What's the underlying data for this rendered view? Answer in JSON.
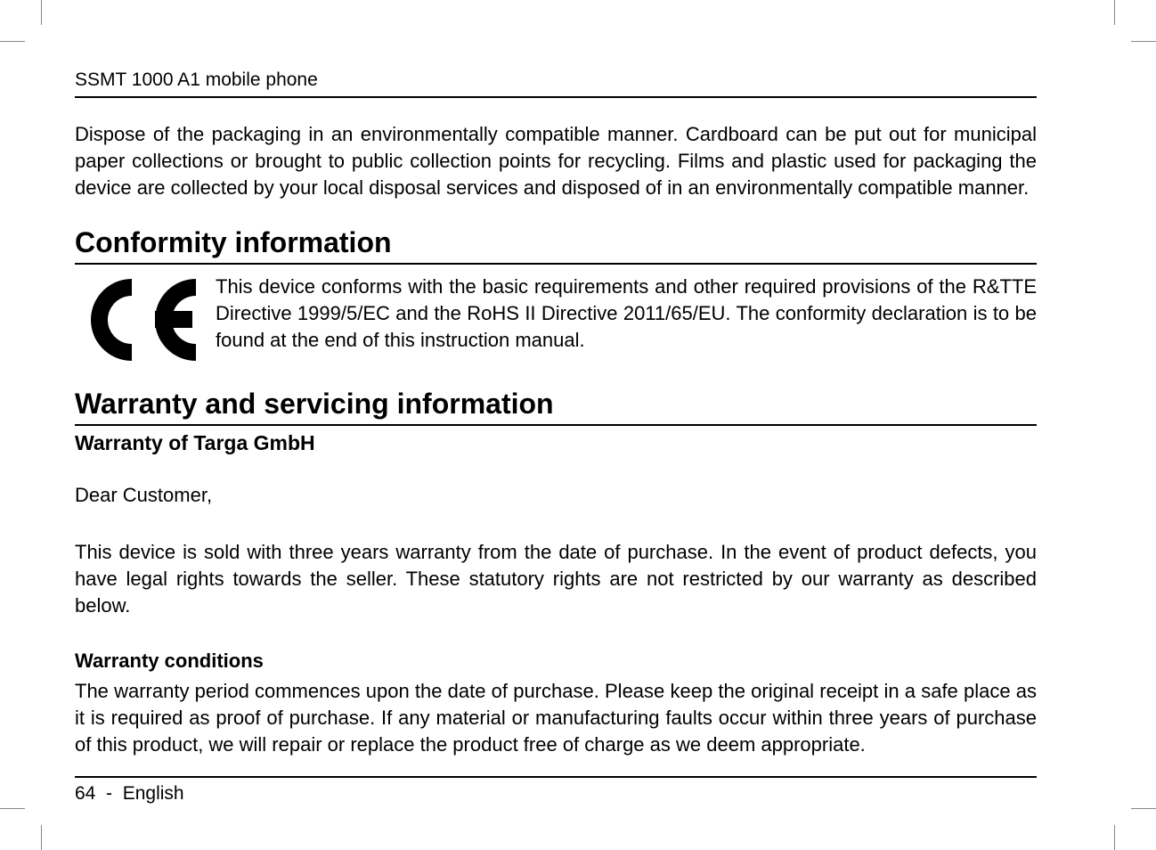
{
  "header": {
    "title": "SSMT 1000 A1 mobile phone"
  },
  "intro_para": "Dispose of the packaging in an environmentally compatible manner. Cardboard can be put out for municipal paper collections or brought to public collection points for recycling. Films and plastic used for packaging the device are collected by your local disposal services and disposed of in an environmentally compatible manner.",
  "conformity": {
    "heading": "Conformity information",
    "text": "This device conforms with the basic requirements and other required provisions of the R&TTE Directive 1999/5/EC and the RoHS II Directive 2011/65/EU. The conformity declaration is to be found at the end of this instruction manual."
  },
  "warranty": {
    "heading": "Warranty and servicing information",
    "subheading": "Warranty of Targa GmbH",
    "salutation": "Dear Customer,",
    "para1": "This device is sold with three years warranty from the date of purchase. In the event of product defects, you have legal rights towards the seller. These statutory rights are not restricted by our warranty as described below.",
    "conditions_heading": "Warranty conditions",
    "conditions_text": "The warranty period commences upon the date of purchase. Please keep the original receipt in a safe place as it is required as proof of purchase. If any material or manufacturing faults occur within three years of purchase of this product, we will repair or replace the product free of charge as we deem appropriate."
  },
  "footer": {
    "page_number": "64",
    "separator": "-",
    "language": "English"
  }
}
